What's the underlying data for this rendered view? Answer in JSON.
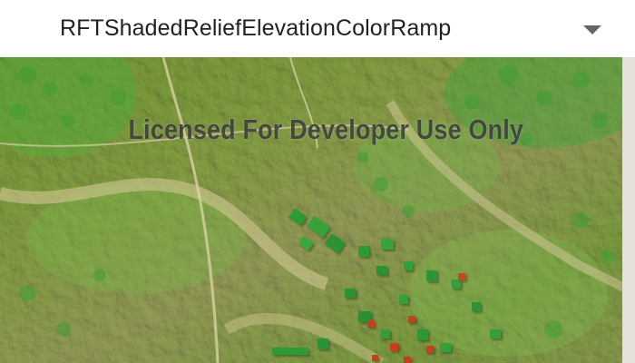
{
  "renderer_dropdown": {
    "selected": "RFTShadedReliefElevationColorRamp",
    "icon": "triangle-down"
  },
  "map": {
    "watermark": "Licensed For Developer Use Only",
    "colors": {
      "low": "#c9c28a",
      "mid": "#a7c95a",
      "high": "#2fa63a",
      "peak": "#c0401f",
      "basemap": "#e6e2da"
    }
  }
}
